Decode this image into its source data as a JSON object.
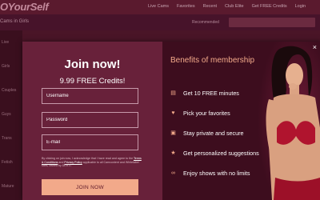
{
  "site": {
    "logo": "OYourSelf",
    "nav": [
      "Live Cams",
      "Favorites",
      "Recent",
      "Club Elite",
      "Get FREE Credits",
      "Login"
    ],
    "subtitle": "Cams in Girls",
    "sort_label": "Recommended",
    "sidebar": [
      "Live",
      "Girls",
      "Couples",
      "Guys",
      "Trans",
      "Fetish",
      "Mature"
    ]
  },
  "modal": {
    "title": "Join now!",
    "credits": "9.99 FREE Credits!",
    "username_placeholder": "Username",
    "password_placeholder": "Password",
    "email_placeholder": "E-mail",
    "legal_prefix": "By clicking on join now, I acknowledge that I have read and agree to the",
    "terms_link": "Terms & Conditions",
    "legal_and": "and",
    "privacy_link": "Privacy Policy",
    "legal_suffix": "applicable to all Camcontent and Whitelabel sites, owned by DERTI.",
    "join_button": "JOIN NOW",
    "close": "×",
    "benefits_title": "Benefits of membership",
    "benefits": [
      {
        "icon": "film-icon",
        "glyph": "▤",
        "text": "Get 10 FREE minutes"
      },
      {
        "icon": "heart-icon",
        "glyph": "♥",
        "text": "Pick your favorites"
      },
      {
        "icon": "lock-icon",
        "glyph": "▣",
        "text": "Stay private and secure"
      },
      {
        "icon": "star-icon",
        "glyph": "★",
        "text": "Get personalized suggestions"
      },
      {
        "icon": "infinity-icon",
        "glyph": "∞",
        "text": "Enjoy shows with no limits"
      }
    ]
  },
  "colors": {
    "accent": "#f2a98a",
    "modal_left": "#68213a",
    "modal_right": "#3d0d1e"
  }
}
